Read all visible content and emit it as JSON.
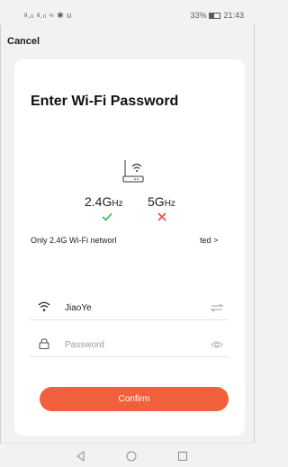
{
  "status_bar": {
    "signal_text": "ᵍ.ₗₗ ᵍ.ₗₗ ≈ ✱ ʊ",
    "battery_percent": "33%",
    "time": "21:43"
  },
  "header": {
    "cancel_label": "Cancel"
  },
  "card": {
    "title": "Enter Wi-Fi Password",
    "band_24_main": "2.4G",
    "band_24_unit": "Hz",
    "band_5_main": "5G",
    "band_5_unit": "Hz",
    "notice_left": "Only 2.4G Wi-Fi networl",
    "notice_right": "ted >",
    "ssid_value": "JiaoYe",
    "password_placeholder": "Password",
    "confirm_label": "Confirm"
  },
  "colors": {
    "accent": "#f0603a",
    "check": "#2db84b",
    "cross": "#f04a4a"
  },
  "icons": {
    "router": "router-wifi-icon",
    "check": "check-icon",
    "cross": "cross-icon",
    "wifi": "wifi-icon",
    "lock": "lock-icon",
    "switch": "switch-network-icon",
    "eye": "eye-icon",
    "back": "back-triangle-icon",
    "home": "home-circle-icon",
    "recents": "recents-square-icon"
  }
}
